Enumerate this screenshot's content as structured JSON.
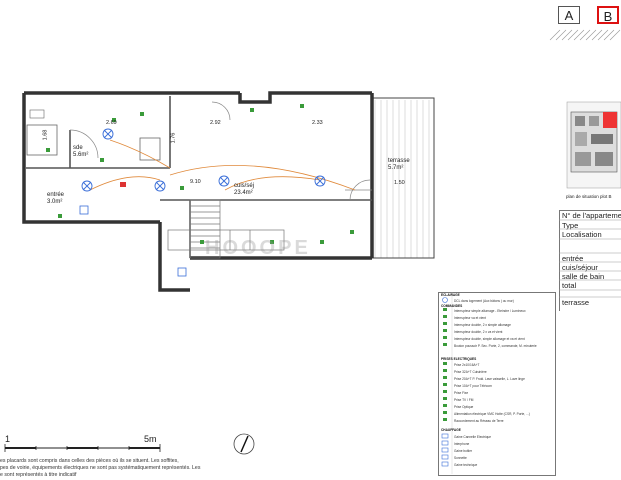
{
  "tabs": [
    {
      "label": "A",
      "active": false
    },
    {
      "label": "B",
      "active": true
    }
  ],
  "plan": {
    "rooms": [
      {
        "name": "sde",
        "area": "5.6m²"
      },
      {
        "name": "entrée",
        "area": "3.0m²"
      },
      {
        "name": "cuis/séj",
        "area": "23.4m²"
      },
      {
        "name": "terrasse",
        "area": "5.7m²"
      }
    ],
    "dimensions": [
      "2.69",
      "2.92",
      "2.33",
      "1.68",
      "1.76",
      "1.50",
      "9.10"
    ],
    "watermark": "HOOOPE",
    "scale": {
      "start": "1",
      "end": "5m"
    }
  },
  "situation": {
    "caption": "plan de situation plot B"
  },
  "info_table": {
    "header": [
      "N° de l'appartement",
      "Type",
      "Localisation"
    ],
    "rows": [
      "entrée",
      "cuis/séjour",
      "salle de bain",
      "total"
    ],
    "footer": "terrasse"
  },
  "legend": {
    "sections": [
      {
        "title": "ECLAIRAGE",
        "items": [
          "DCL dans logement (Aux bâtons ) ou mur)"
        ]
      },
      {
        "title": "COMMANDES",
        "items": [
          "Interrupteur simple allumage - Eteindre / Lumineux",
          "Interrupteur va et vient",
          "Interrupteur double, 2 x simple allumage",
          "Interrupteur double, 2 x va et vient",
          "Interrupteur double, simple allumage et va et vient",
          "Bouton poussoir P. Sec. Porte, 2, commande, M. minuterie"
        ]
      },
      {
        "title": "PRISES ELECTRIQUES",
        "items": [
          "Prise 2x10/16A+T",
          "Prise 32A+T Cuisinière",
          "Prise 20A+T P. Froid. Lave vaisselle, L. Lave linge",
          "Prise 10A+T pour Télécom",
          "Prise Fixe",
          "Prise TV / FM",
          "Prise Optique",
          "Alimentation électrique VMC Hotte (CSR, P. Porte, ...)",
          "Raccordement au Réseau de Terre"
        ]
      },
      {
        "title": "CHAUFFAGE",
        "items": [
          "Gaine Cannelle Electrique",
          "Interphone",
          "Gaine boitier",
          "Sonnette",
          "Gaine technique"
        ]
      }
    ]
  },
  "notes": [
    "es placards sont compris dans celles des pièces où ils se situent. Les soffites,",
    "pes de voirie, équipements électriques ne sont pas systématiquement représentés. Les",
    "e sont représentés à titre indicatif"
  ]
}
